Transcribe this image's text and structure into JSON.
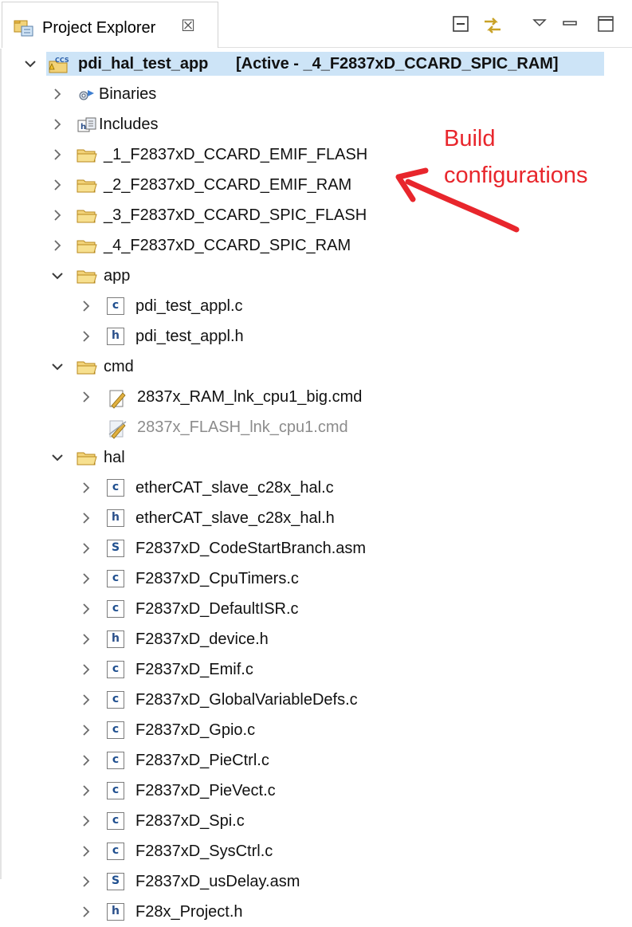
{
  "panel": {
    "tab_title": "Project Explorer",
    "tab_close": "☒",
    "icons": [
      "project-explorer-icon",
      "collapse-all-icon",
      "link-with-editor-icon",
      "view-menu-icon",
      "minimize-icon",
      "maximize-icon"
    ]
  },
  "tree": {
    "project": {
      "badge": "CCS",
      "name": "pdi_hal_test_app",
      "config": "[Active - _4_F2837xD_CCARD_SPIC_RAM]"
    },
    "binaries": "Binaries",
    "includes": "Includes",
    "configs": [
      "_1_F2837xD_CCARD_EMIF_FLASH",
      "_2_F2837xD_CCARD_EMIF_RAM",
      "_3_F2837xD_CCARD_SPIC_FLASH",
      "_4_F2837xD_CCARD_SPIC_RAM"
    ],
    "app": {
      "name": "app",
      "files": [
        {
          "name": "pdi_test_appl.c",
          "kind": "c"
        },
        {
          "name": "pdi_test_appl.h",
          "kind": "h"
        }
      ]
    },
    "cmd": {
      "name": "cmd",
      "files": [
        {
          "name": "2837x_RAM_lnk_cpu1_big.cmd",
          "excluded": false
        },
        {
          "name": "2837x_FLASH_lnk_cpu1.cmd",
          "excluded": true
        }
      ]
    },
    "hal": {
      "name": "hal",
      "files": [
        {
          "name": "etherCAT_slave_c28x_hal.c",
          "kind": "c"
        },
        {
          "name": "etherCAT_slave_c28x_hal.h",
          "kind": "h"
        },
        {
          "name": "F2837xD_CodeStartBranch.asm",
          "kind": "s"
        },
        {
          "name": "F2837xD_CpuTimers.c",
          "kind": "c"
        },
        {
          "name": "F2837xD_DefaultISR.c",
          "kind": "c"
        },
        {
          "name": "F2837xD_device.h",
          "kind": "h"
        },
        {
          "name": "F2837xD_Emif.c",
          "kind": "c"
        },
        {
          "name": "F2837xD_GlobalVariableDefs.c",
          "kind": "c"
        },
        {
          "name": "F2837xD_Gpio.c",
          "kind": "c"
        },
        {
          "name": "F2837xD_PieCtrl.c",
          "kind": "c"
        },
        {
          "name": "F2837xD_PieVect.c",
          "kind": "c"
        },
        {
          "name": "F2837xD_Spi.c",
          "kind": "c"
        },
        {
          "name": "F2837xD_SysCtrl.c",
          "kind": "c"
        },
        {
          "name": "F2837xD_usDelay.asm",
          "kind": "s"
        },
        {
          "name": "F28x_Project.h",
          "kind": "h"
        }
      ]
    }
  },
  "annotation": {
    "line1": "Build",
    "line2": "configurations",
    "color": "#e8262c"
  },
  "file_glyphs": {
    "c": "c",
    "h": "h",
    "s": "S"
  },
  "colors": {
    "selection": "#cde4f7",
    "folder": "#e8b84a",
    "excluded_text": "#8c8c8c"
  }
}
